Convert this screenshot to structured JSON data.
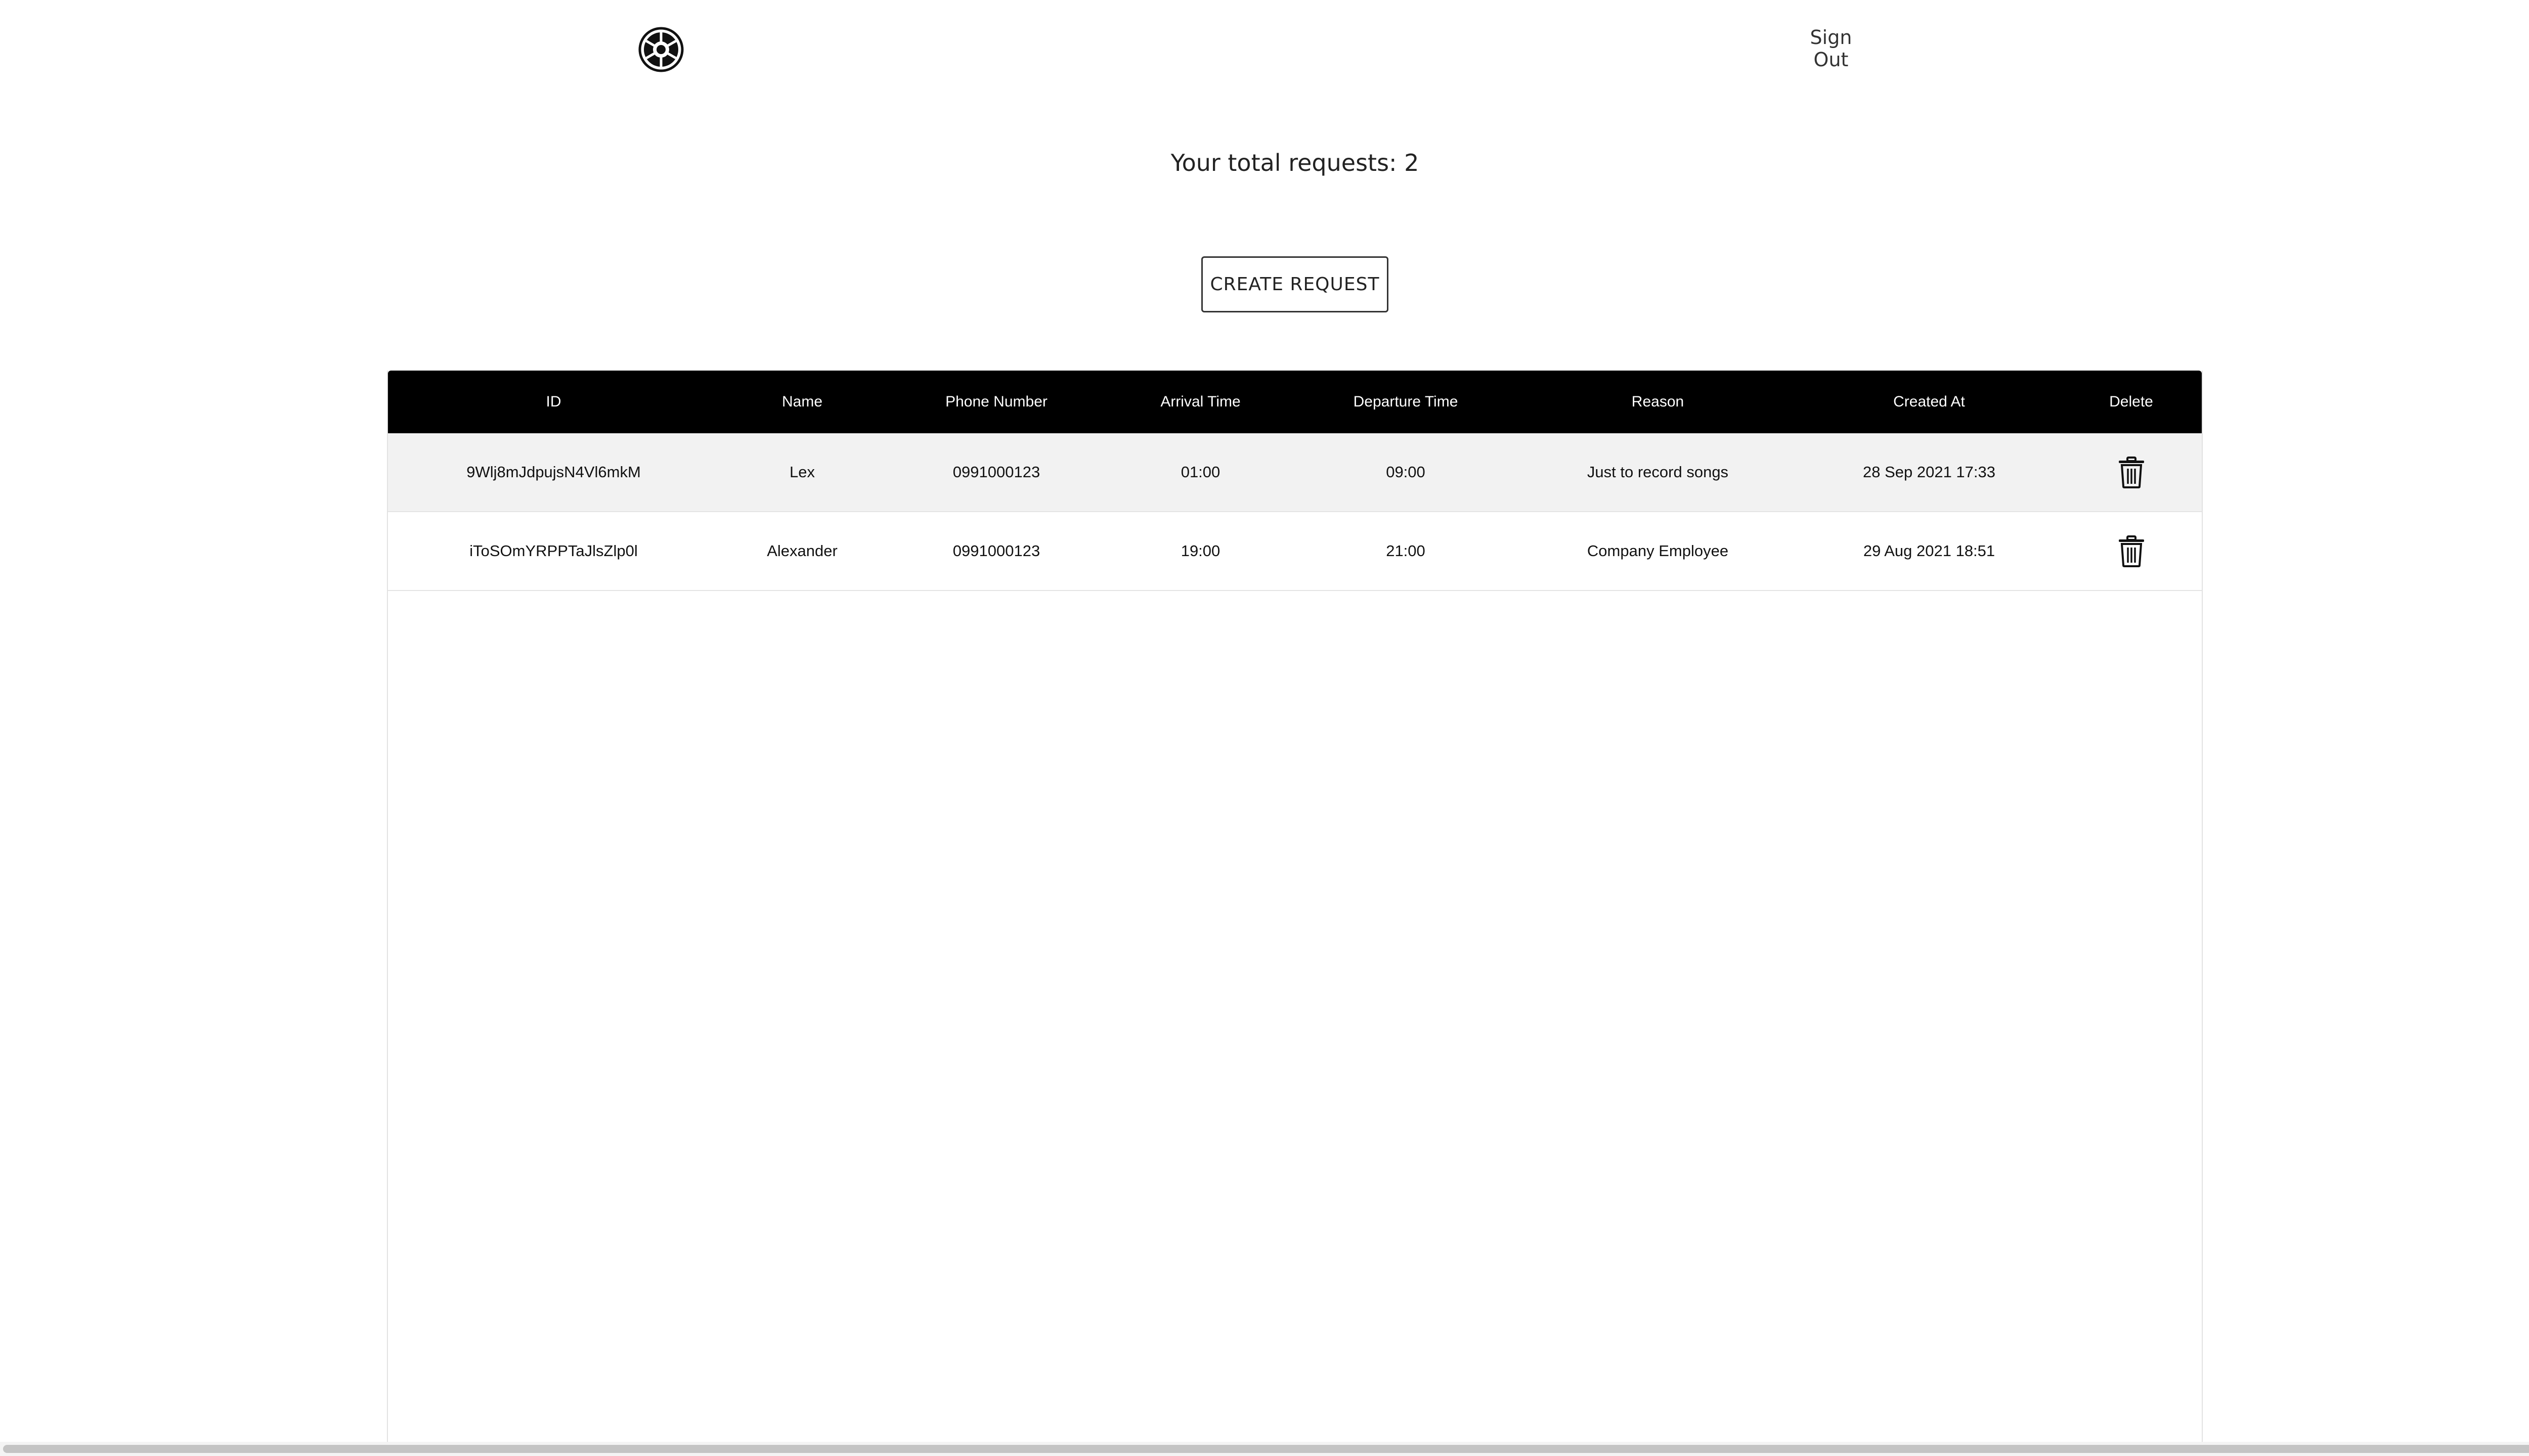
{
  "header": {
    "logo_icon": "galactic-empire-logo-icon",
    "sign_out_label": "Sign Out"
  },
  "summary": {
    "total_text": "Your total requests: 2"
  },
  "actions": {
    "create_label": "CREATE REQUEST"
  },
  "table": {
    "columns": [
      "ID",
      "Name",
      "Phone Number",
      "Arrival Time",
      "Departure Time",
      "Reason",
      "Created At",
      "Delete"
    ],
    "rows": [
      {
        "id": "9Wlj8mJdpujsN4Vl6mkM",
        "name": "Lex",
        "phone": "0991000123",
        "arrival": "01:00",
        "departure": "09:00",
        "reason": "Just to record songs",
        "created_at": "28 Sep 2021 17:33",
        "delete_icon": "trash-icon"
      },
      {
        "id": "iToSOmYRPPTaJlsZlp0l",
        "name": "Alexander",
        "phone": "0991000123",
        "arrival": "19:00",
        "departure": "21:00",
        "reason": "Company Employee",
        "created_at": "29 Aug 2021 18:51",
        "delete_icon": "trash-icon"
      }
    ]
  },
  "colors": {
    "header_bg": "#000000",
    "header_text": "#ffffff",
    "row_shade": "#f2f2f2"
  }
}
